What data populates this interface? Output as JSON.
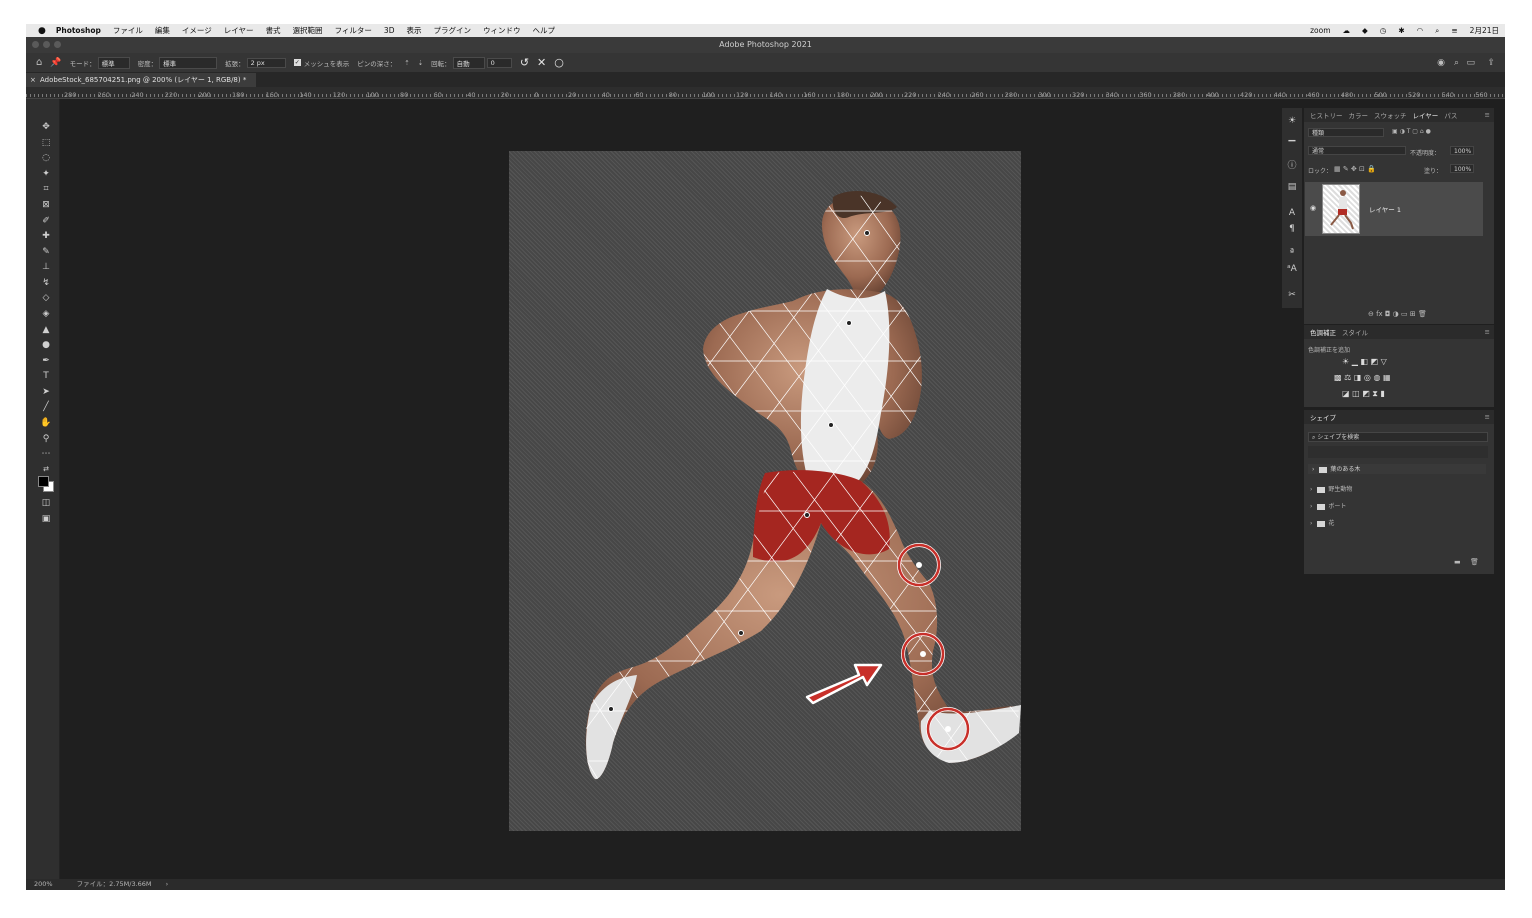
{
  "menubar": {
    "app_name": "Photoshop",
    "items": [
      "ファイル",
      "編集",
      "イメージ",
      "レイヤー",
      "書式",
      "選択範囲",
      "フィルター",
      "3D",
      "表示",
      "プラグイン",
      "ウィンドウ",
      "ヘルプ"
    ],
    "right_zoom": "zoom",
    "right_time": "2月21日"
  },
  "window": {
    "title": "Adobe Photoshop 2021"
  },
  "options": {
    "mode_label": "モード：",
    "mode_value": "標準",
    "density_label": "密度：",
    "density_value": "標準",
    "expand_label": "拡張：",
    "expand_value": "2 px",
    "show_mesh_label": "メッシュを表示",
    "pin_depth_label": "ピンの深さ：",
    "rotate_label": "回転：",
    "rotate_mode": "自動",
    "rotate_value": "0"
  },
  "document": {
    "tab_title": "AdobeStock_685704251.png @ 200% (レイヤー 1, RGB/8) *"
  },
  "ruler": {
    "ticks": [
      "280",
      "260",
      "240",
      "220",
      "200",
      "180",
      "160",
      "140",
      "120",
      "100",
      "80",
      "60",
      "40",
      "20",
      "0",
      "20",
      "40",
      "60",
      "80",
      "100",
      "120",
      "140",
      "160",
      "180",
      "200",
      "220",
      "240",
      "260",
      "280",
      "300",
      "320",
      "340",
      "360",
      "380",
      "400",
      "420",
      "440",
      "460",
      "480",
      "500",
      "520",
      "540",
      "560"
    ]
  },
  "status": {
    "zoom": "200%",
    "file": "ファイル：2.75M/3.66M"
  },
  "layers_panel": {
    "tabs": [
      "ヒストリー",
      "カラー",
      "スウォッチ",
      "レイヤー",
      "パス"
    ],
    "active_tab": "レイヤー",
    "search_placeholder": "種類",
    "blend_mode": "通常",
    "opacity_label": "不透明度：",
    "opacity_value": "100%",
    "lock_label": "ロック：",
    "fill_label": "塗り：",
    "fill_value": "100%",
    "layer_name": "レイヤー 1"
  },
  "adjustments_panel": {
    "tabs": [
      "色調補正",
      "スタイル"
    ],
    "hint": "色調補正を追加"
  },
  "shapes_panel": {
    "tab": "シェイプ",
    "search_placeholder": "シェイプを検索",
    "folders": [
      "葉のある木",
      "野生動物",
      "ボート",
      "花"
    ]
  },
  "colors": {
    "menubar_bg": "#e9e9e9",
    "app_bg": "#1f1f1f",
    "panel_bg": "#343434",
    "highlight_red": "#c8302a",
    "mesh_line": "#ffffff"
  }
}
